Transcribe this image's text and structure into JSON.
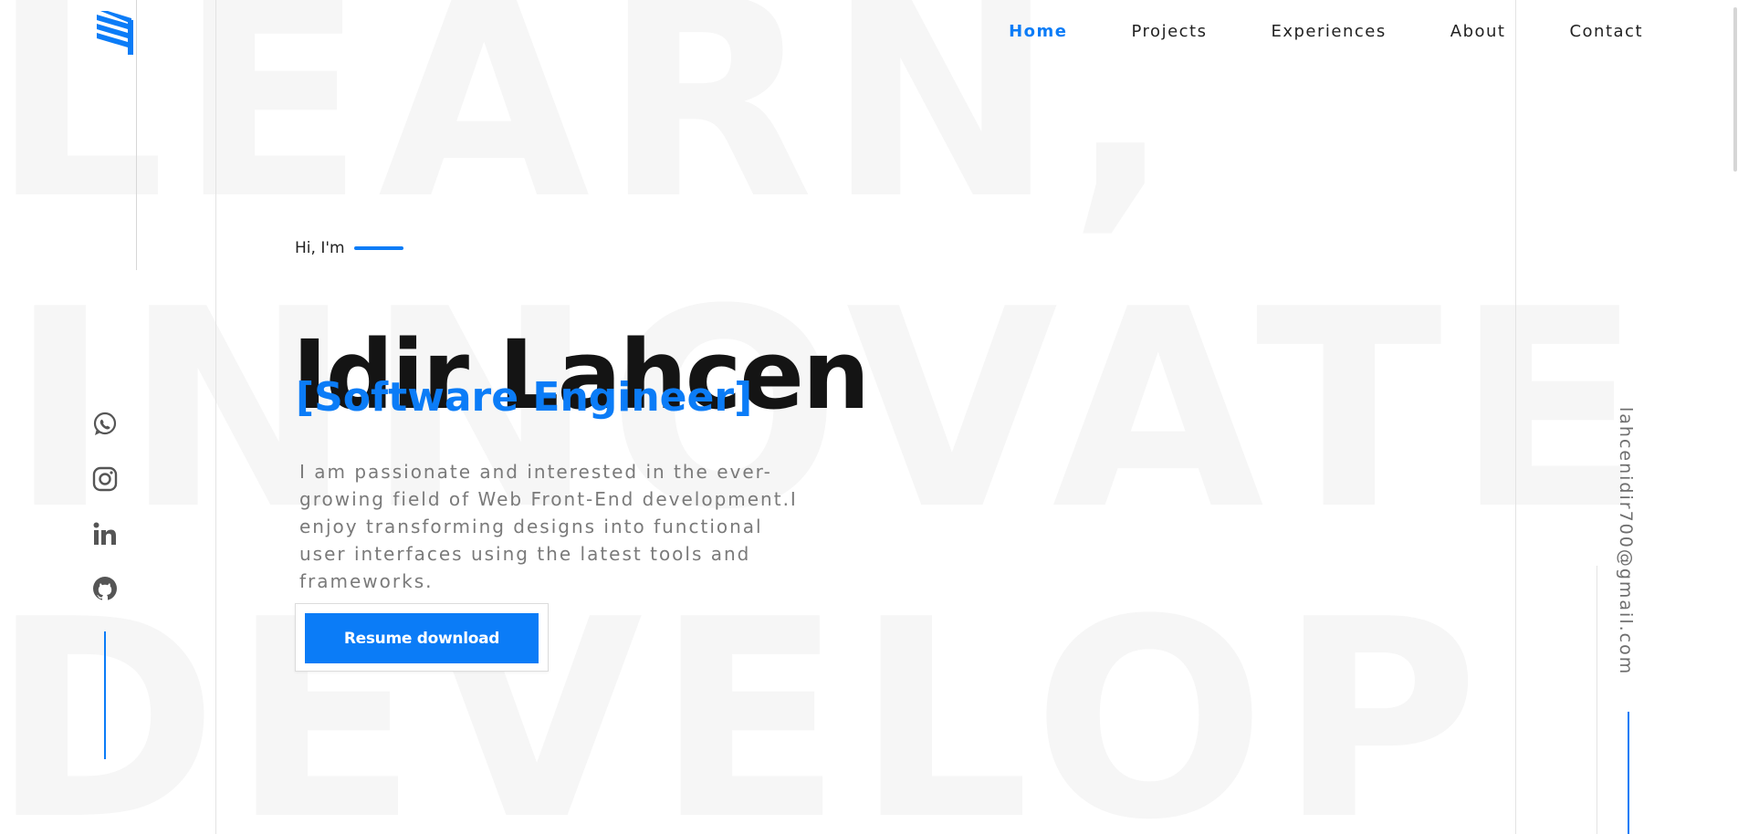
{
  "background_words": [
    "LEARN,",
    "INNOVATE",
    "DEVELOP"
  ],
  "brand": {
    "logo_icon": "stacked-bars-logo-icon",
    "accent_color": "#0b7cf7"
  },
  "nav": {
    "items": [
      {
        "label": "Home",
        "active": true
      },
      {
        "label": "Projects",
        "active": false
      },
      {
        "label": "Experiences",
        "active": false
      },
      {
        "label": "About",
        "active": false
      },
      {
        "label": "Contact",
        "active": false
      }
    ]
  },
  "hero": {
    "greeting": "Hi, I'm",
    "name": "Idir Lahcen",
    "role": "[Software Engineer]",
    "bio": "I am passionate and interested in the ever-growing field of Web Front-End development.I enjoy transforming designs into functional user interfaces using the latest tools and frameworks.",
    "resume_label": "Resume download"
  },
  "social": {
    "icons": [
      "whatsapp-icon",
      "instagram-icon",
      "linkedin-icon",
      "github-icon"
    ]
  },
  "contact": {
    "email": "lahcenidir700@gmail.com"
  }
}
